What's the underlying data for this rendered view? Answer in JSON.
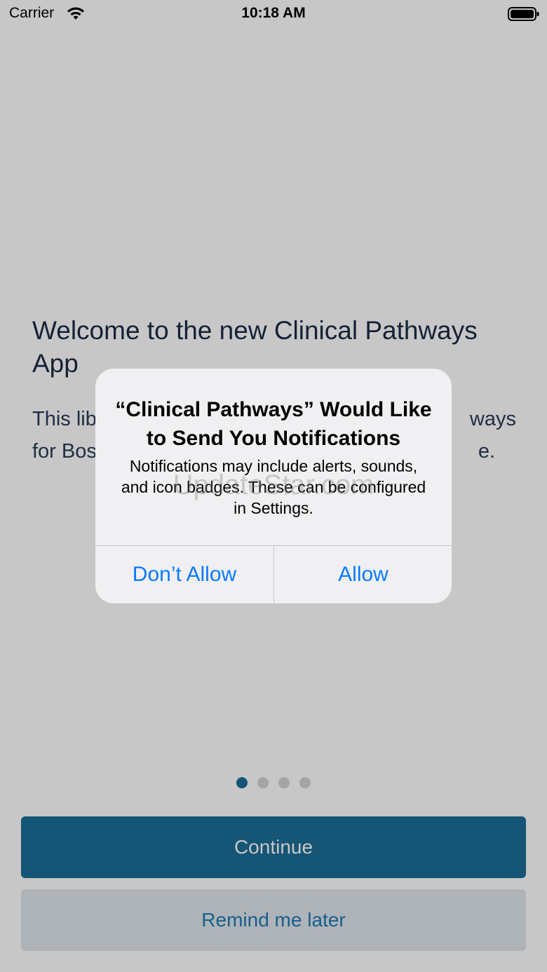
{
  "status_bar": {
    "carrier": "Carrier",
    "time": "10:18 AM",
    "icons": [
      "wifi-icon",
      "battery-icon"
    ]
  },
  "welcome": {
    "title": "Welcome to the new Clinical Pathways App",
    "body_visible_left_line1": "This lib",
    "body_visible_right_line1": "ways",
    "body_visible_left_line2": "for Bos",
    "body_visible_right_line2": "e."
  },
  "pagination": {
    "total": 4,
    "active_index": 0
  },
  "buttons": {
    "continue": "Continue",
    "remind_later": "Remind me later"
  },
  "alert": {
    "title": "“Clinical Pathways” Would Like to Send You Notifications",
    "message": "Notifications may include alerts, sounds, and icon badges. These can be configured in Settings.",
    "deny": "Don’t Allow",
    "allow": "Allow"
  },
  "watermark": "UpdateStar.com",
  "colors": {
    "primary": "#1c6d97",
    "link": "#1f7ab4",
    "ios_blue": "#0a7aff",
    "text_dark": "#1c2b45"
  }
}
